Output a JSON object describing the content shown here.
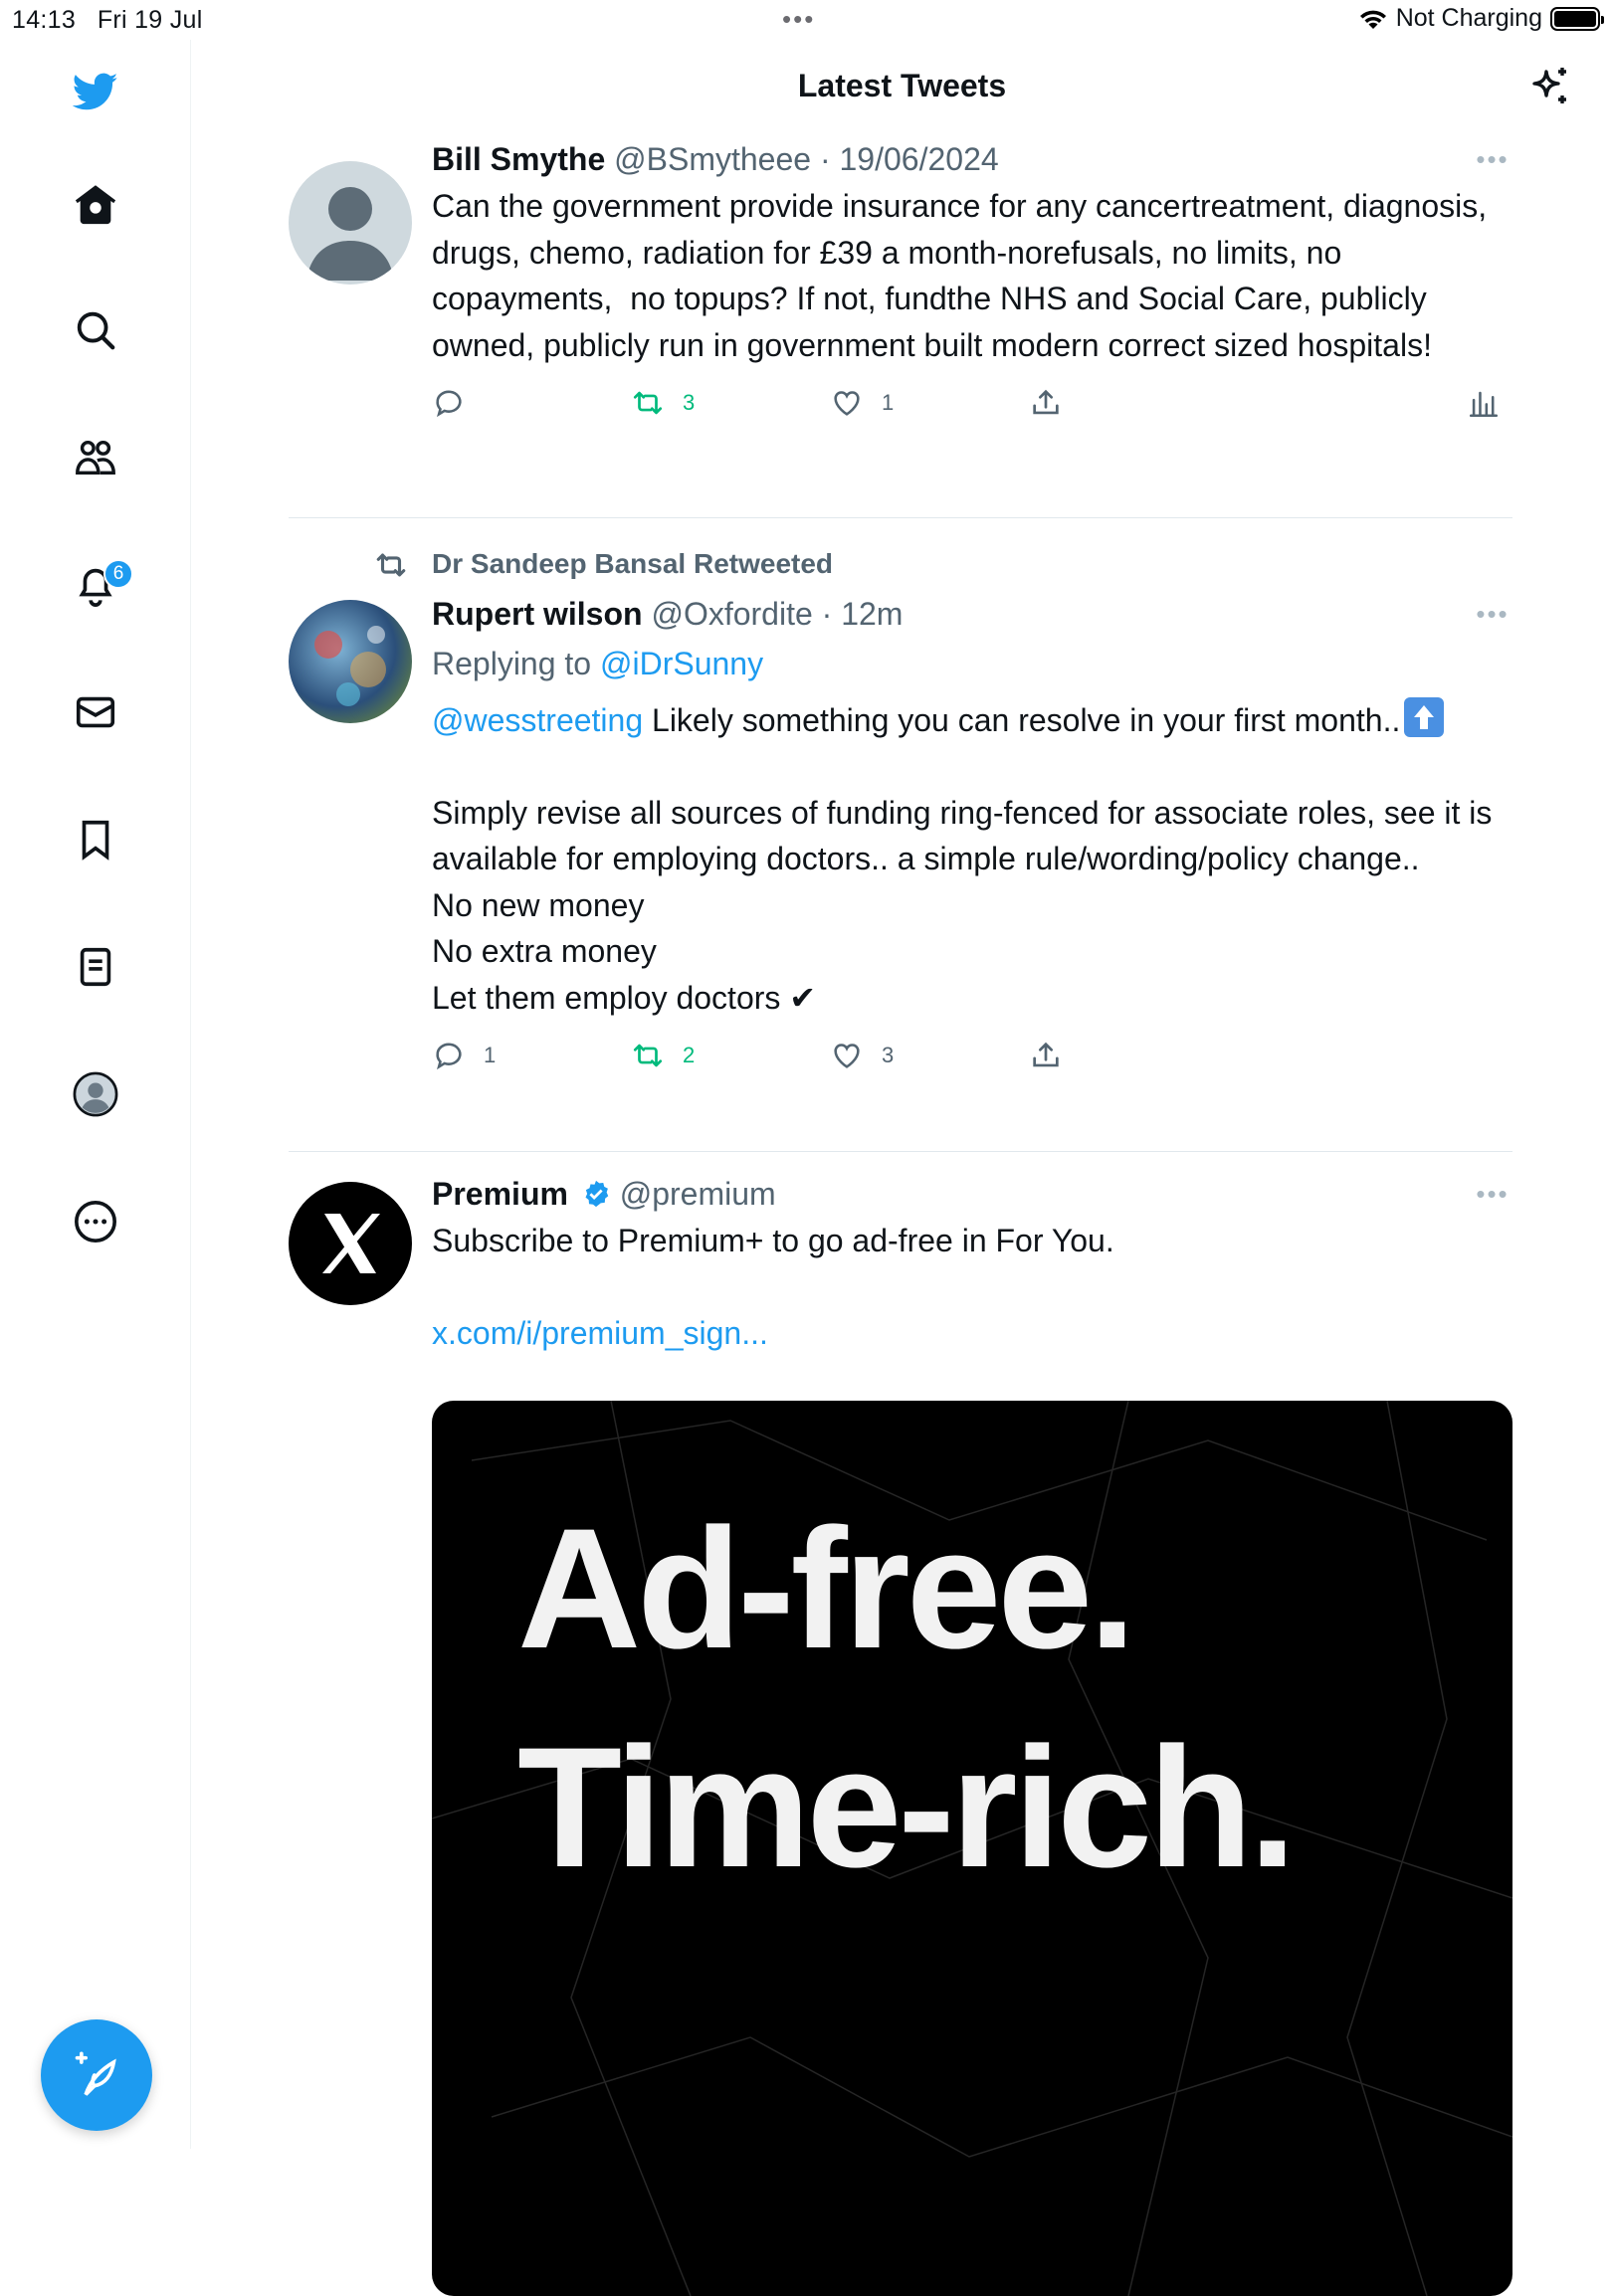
{
  "status": {
    "time": "14:13",
    "date": "Fri 19 Jul",
    "dots": "•••",
    "charging": "Not Charging"
  },
  "header": {
    "title": "Latest Tweets"
  },
  "sidebar": {
    "notification_count": "6",
    "items": [
      "twitter-logo",
      "home-icon",
      "search-icon",
      "communities-icon",
      "bell-icon",
      "mail-icon",
      "bookmark-icon",
      "lists-icon",
      "profile-avatar",
      "more-circle-icon"
    ]
  },
  "colors": {
    "accent": "#1d9bf0",
    "retweet_green": "#00ba7c",
    "muted": "#536471"
  },
  "tweets": [
    {
      "name": "Bill Smythe",
      "handle": "@BSmytheee",
      "sep": " · ",
      "time": "19/06/2024",
      "text": "Can the government provide insurance for any cancertreatment, diagnosis, drugs, chemo, radiation for £39 a month-norefusals, no limits, no copayments,  no topups? If not, fundthe NHS and Social Care, publicly owned, publicly run in government built modern correct sized hospitals!",
      "replies": "",
      "retweets": "3",
      "likes": "1"
    },
    {
      "retweeted_by": "Dr Sandeep Bansal Retweeted",
      "name": "Rupert wilson",
      "handle": "@Oxfordite",
      "sep": " · ",
      "time": "12m",
      "replying_prefix": "Replying to ",
      "replying_to": "@iDrSunny",
      "mention": "@wesstreeting",
      "text_line1": " Likely something you can resolve in your first month..",
      "text_rest": "Simply revise all sources of funding ring-fenced for associate roles, see it is available for employing doctors.. a simple rule/wording/policy change..\nNo new money\nNo extra money\nLet them employ doctors ✔",
      "replies": "1",
      "retweets": "2",
      "likes": "3"
    },
    {
      "name": "Premium",
      "handle": "@premium",
      "text": "Subscribe to Premium+ to go ad-free in For You.",
      "link": "x.com/i/premium_sign...",
      "ad_line1": "Ad-free.",
      "ad_line2": "Time-rich."
    }
  ]
}
